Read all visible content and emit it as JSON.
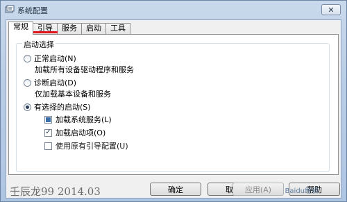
{
  "window": {
    "title": "系统配置",
    "close_glyph": "✕"
  },
  "tabs": [
    {
      "label": "常规",
      "active": true
    },
    {
      "label": "引导",
      "active": false
    },
    {
      "label": "服务",
      "active": false
    },
    {
      "label": "启动",
      "active": false
    },
    {
      "label": "工具",
      "active": false
    }
  ],
  "startup_selection": {
    "legend": "启动选择",
    "options": [
      {
        "label": "正常启动(N)",
        "description": "加载所有设备驱动程序和服务",
        "selected": false
      },
      {
        "label": "诊断启动(D)",
        "description": "仅加载基本设备和服务",
        "selected": false
      },
      {
        "label": "有选择的启动(S)",
        "selected": true
      }
    ],
    "selective_items": [
      {
        "label": "加载系统服务(L)",
        "state": "mixed"
      },
      {
        "label": "加载启动项(O)",
        "state": "checked"
      },
      {
        "label": "使用原有引导配置(U)",
        "state": "unchecked"
      }
    ]
  },
  "footer": {
    "watermark": "壬辰龙99  2014.03",
    "buttons": {
      "ok": "确定",
      "cancel": "取消",
      "apply": "应用(A)",
      "help": "帮助"
    },
    "overlay_watermark": "Baidu经验"
  },
  "colors": {
    "accent_underline": "#e0141a",
    "title_bar": "#c9d9ec"
  }
}
